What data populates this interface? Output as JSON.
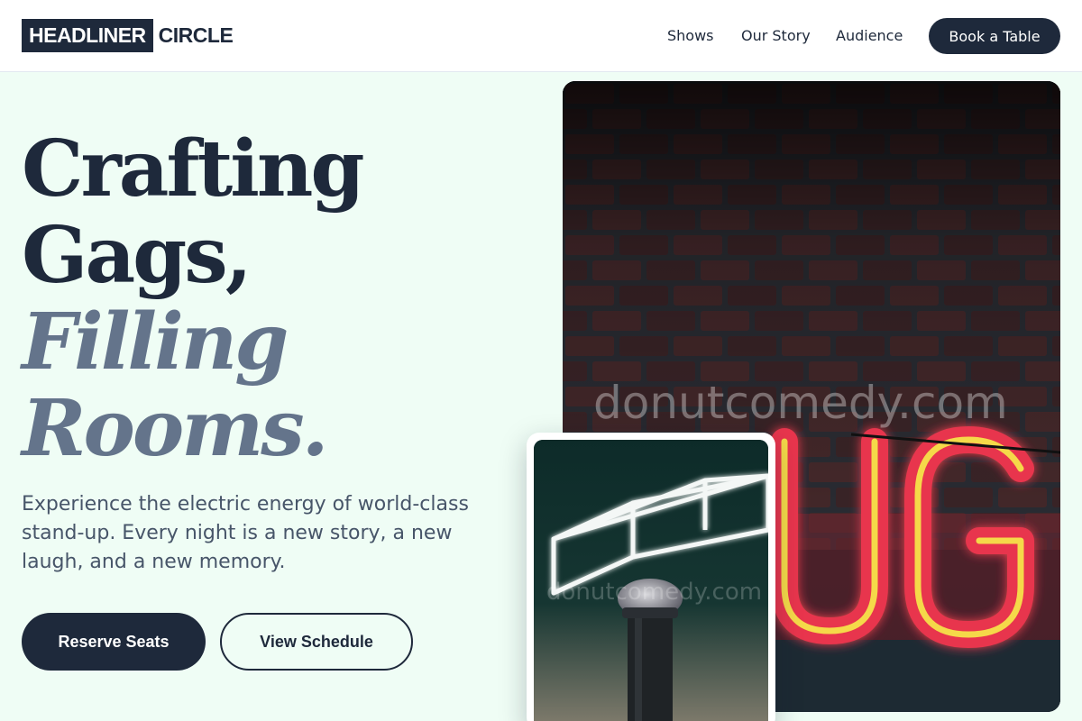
{
  "header": {
    "logo_box": "HEADLINER",
    "logo_rest": "CIRCLE",
    "nav": [
      {
        "label": "Shows"
      },
      {
        "label": "Our Story"
      },
      {
        "label": "Audience"
      }
    ],
    "cta_label": "Book a Table"
  },
  "hero": {
    "headline_lines": [
      "Crafting",
      "Gags,",
      "Filling",
      "Rooms."
    ],
    "lede": "Experience the electric energy of world-class stand-up. Every night is a new story, a new laugh, and a new memory.",
    "primary_button": "Reserve Seats",
    "secondary_button": "View Schedule"
  },
  "images": {
    "main_neon_text": "UG",
    "watermark": "donutcomedy.com"
  },
  "colors": {
    "brand_dark": "#1e293b",
    "accent_slate": "#64748b",
    "page_bg": "#effdf5",
    "neon_red": "#e8344e",
    "neon_yellow": "#f5d94a"
  }
}
